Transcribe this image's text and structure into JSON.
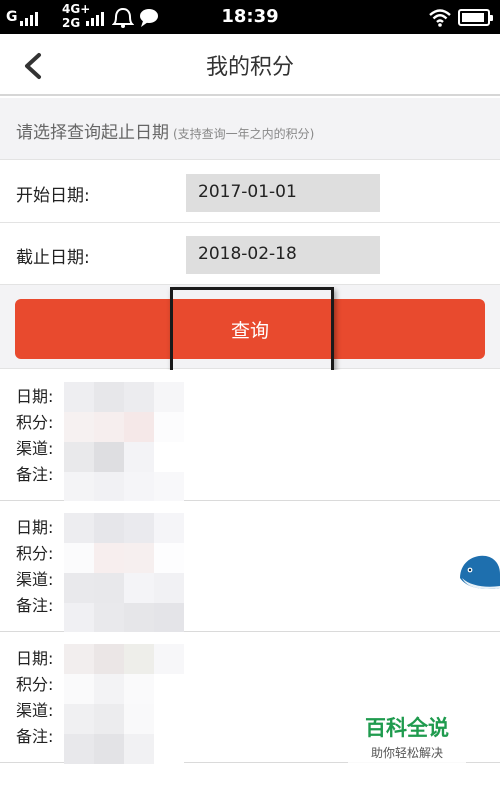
{
  "status_bar": {
    "carrier": "G",
    "network_top": "4G+",
    "network_bottom": "2G",
    "time": "18:39"
  },
  "nav": {
    "back_icon": "chevron-left-icon",
    "title": "我的积分"
  },
  "section": {
    "header": "请选择查询起止日期",
    "hint": "(支持查询一年之内的积分)"
  },
  "form": {
    "start_label": "开始日期:",
    "start_value": "2017-01-01",
    "end_label": "截止日期:",
    "end_value": "2018-02-18"
  },
  "query_button": {
    "label": "查询",
    "color": "#e84a2e"
  },
  "records": [
    {
      "date_label": "日期:",
      "points_label": "积分:",
      "channel_label": "渠道:",
      "note_label": "备注:"
    },
    {
      "date_label": "日期:",
      "points_label": "积分:",
      "channel_label": "渠道:",
      "note_label": "备注:"
    },
    {
      "date_label": "日期:",
      "points_label": "积分:",
      "channel_label": "渠道:",
      "note_label": "备注:"
    }
  ],
  "watermark": {
    "title": "百科全说",
    "subtitle": "助你轻松解决"
  },
  "colors": {
    "accent": "#e84a2e",
    "watermark_green": "#1f9b4e"
  }
}
